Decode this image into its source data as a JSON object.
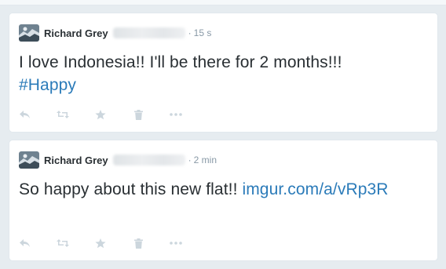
{
  "tweets": [
    {
      "author": "Richard Grey",
      "time": "15 s",
      "text": "I love Indonesia!! I'll be there for 2 months!!!",
      "link": "#Happy"
    },
    {
      "author": "Richard Grey",
      "time": "2 min",
      "text": "So happy about this new flat!! ",
      "link": "imgur.com/a/vRp3R"
    }
  ],
  "separator": "·",
  "icons": [
    "reply-icon",
    "retweet-icon",
    "favorite-icon",
    "delete-icon",
    "more-icon"
  ],
  "colors": {
    "link": "#2b7bb9",
    "text": "#292f33",
    "muted": "#8899a6",
    "icon": "#ccd6dd"
  }
}
